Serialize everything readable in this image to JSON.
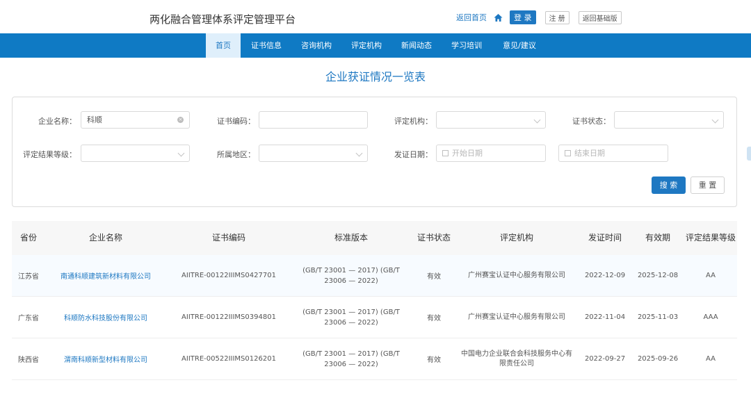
{
  "header": {
    "site_title": "两化融合管理体系评定管理平台",
    "back_home": "返回首页",
    "home_icon": "home-icon",
    "login": "登 录",
    "register": "注 册",
    "basic_version": "返回基础版"
  },
  "nav": {
    "items": [
      "首页",
      "证书信息",
      "咨询机构",
      "评定机构",
      "新闻动态",
      "学习培训",
      "意见/建议"
    ],
    "active_index": 0
  },
  "page_title": "企业获证情况一览表",
  "search": {
    "company_label": "企业名称：",
    "company_value": "科顺",
    "cert_code_label": "证书编码：",
    "cert_code_value": "",
    "org_label": "评定机构：",
    "status_label": "证书状态：",
    "grade_label": "评定结果等级：",
    "region_label": "所属地区：",
    "date_label": "发证日期：",
    "start_date_placeholder": "开始日期",
    "end_date_placeholder": "结束日期",
    "search_button": "搜 索",
    "reset_button": "重 置"
  },
  "table": {
    "columns": [
      "省份",
      "企业名称",
      "证书编码",
      "标准版本",
      "证书状态",
      "评定机构",
      "发证时间",
      "有效期",
      "评定结果等级"
    ],
    "rows": [
      {
        "province": "江苏省",
        "company": "南通科顺建筑新材料有限公司",
        "code": "AIITRE-00122IIIMS0427701",
        "standard_l1": "(GB/T 23001 — 2017)   (GB/T",
        "standard_l2": "23006 — 2022)",
        "status": "有效",
        "org": "广州赛宝认证中心服务有限公司",
        "issued": "2022-12-09",
        "valid": "2025-12-08",
        "grade": "AA"
      },
      {
        "province": "广东省",
        "company": "科顺防水科技股份有限公司",
        "code": "AIITRE-00122IIIMS0394801",
        "standard_l1": "(GB/T 23001 — 2017)   (GB/T",
        "standard_l2": "23006 — 2022)",
        "status": "有效",
        "org": "广州赛宝认证中心服务有限公司",
        "issued": "2022-11-04",
        "valid": "2025-11-03",
        "grade": "AAA"
      },
      {
        "province": "陕西省",
        "company": "渭南科顺新型材料有限公司",
        "code": "AIITRE-00522IIIMS0126201",
        "standard_l1": "(GB/T 23001 — 2017)   (GB/T",
        "standard_l2": "23006 — 2022)",
        "status": "有效",
        "org": "中国电力企业联合会科技服务中心有限责任公司",
        "issued": "2022-09-27",
        "valid": "2025-09-26",
        "grade": "AA"
      }
    ]
  },
  "colors": {
    "brand_blue": "#1e78c2",
    "nav_blue": "#0f7ac4"
  }
}
